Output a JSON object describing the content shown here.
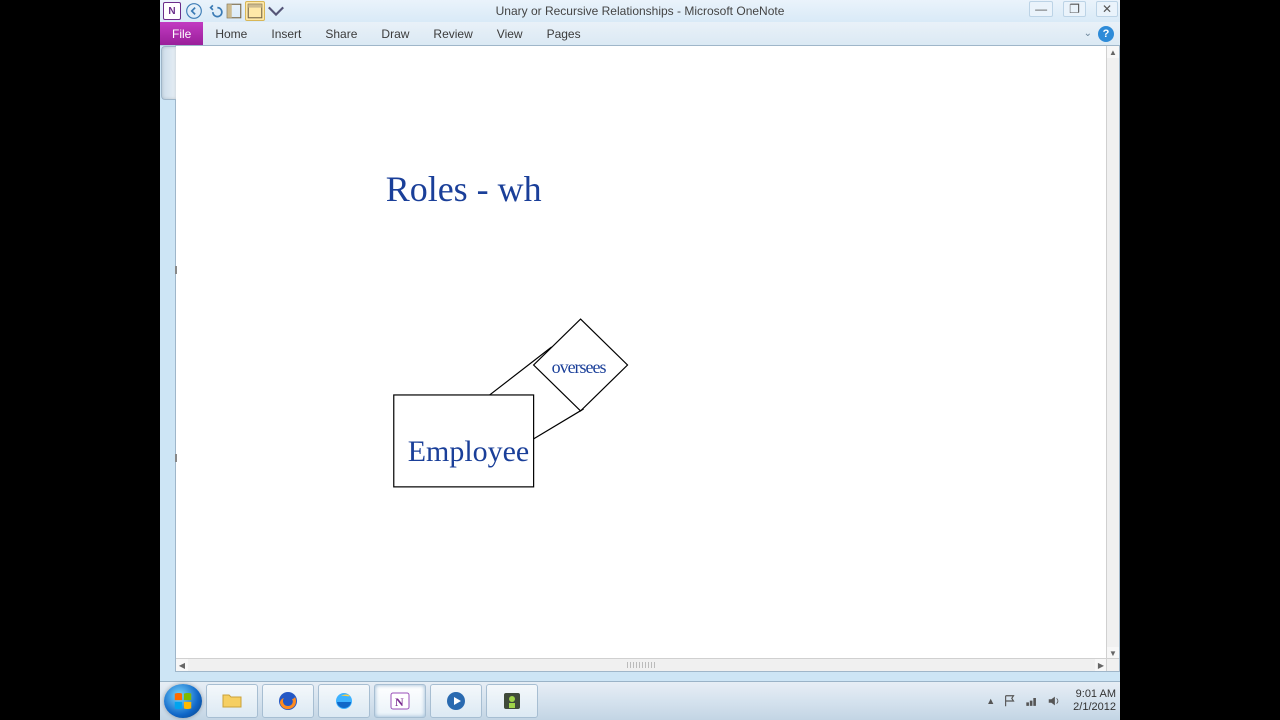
{
  "window": {
    "title": "Unary or Recursive Relationships  -  Microsoft OneNote"
  },
  "ribbon": {
    "file": "File",
    "tabs": [
      "Home",
      "Insert",
      "Share",
      "Draw",
      "Review",
      "View",
      "Pages"
    ]
  },
  "page": {
    "heading": "Roles - wh",
    "entity_label": "Employee",
    "relationship_label": "oversees"
  },
  "tray": {
    "time": "9:01 AM",
    "date": "2/1/2012"
  },
  "chart_data": {
    "type": "erd",
    "title": "Roles - wh",
    "entities": [
      {
        "name": "Employee",
        "shape": "rectangle"
      }
    ],
    "relationships": [
      {
        "name": "oversees",
        "shape": "diamond",
        "connects": [
          "Employee",
          "Employee"
        ],
        "kind": "unary-recursive"
      }
    ]
  }
}
